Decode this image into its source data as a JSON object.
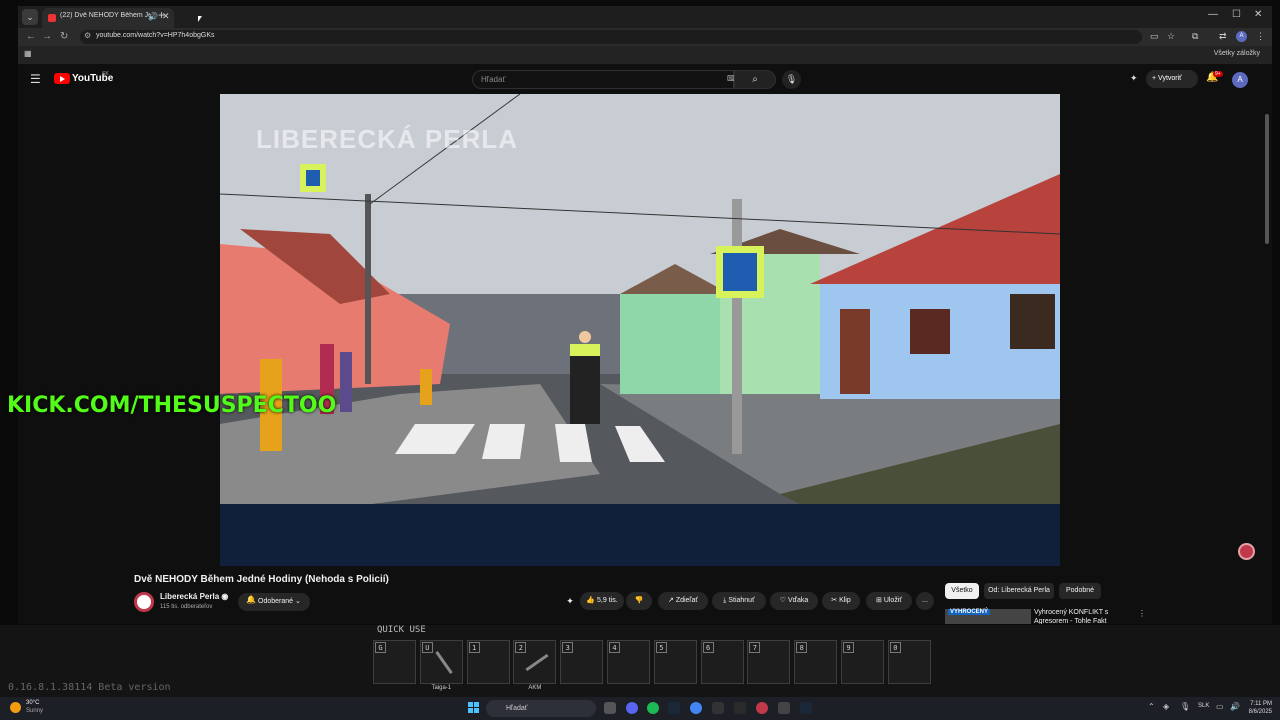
{
  "browser": {
    "tab_title": "(22) Dvě NEHODY Během Jedné Hodiny (Nehoda s Policií) - YouTube",
    "url": "youtube.com/watch?v=HP7h4obgGKs",
    "bookmarks_label": "Všetky záložky",
    "avatar_letter": "A"
  },
  "youtube": {
    "logo_text": "YouTube",
    "country": "SK",
    "search_placeholder": "Hľadať",
    "create_label": "Vytvoriť",
    "notif_count": "9+",
    "avatar_letter": "A"
  },
  "video": {
    "overlay_channel": "LIBERECKÁ PERLA",
    "kick_overlay": "KICK.COM/THESUSPECTOO",
    "title": "Dvě NEHODY Během Jedné Hodiny (Nehoda s Policií)",
    "channel_name": "Liberecká Perla",
    "channel_subs": "115 tis. odberateľov",
    "subscribe_label": "Odoberané",
    "likes": "5,9 tis.",
    "share_label": "Zdieľať",
    "download_label": "Stiahnuť",
    "thanks_label": "Vďaka",
    "clip_label": "Klip",
    "save_label": "Uložiť",
    "more_label": "..."
  },
  "recommendations": {
    "chips": [
      "Všetko",
      "Od: Liberecká Perla",
      "Podobné"
    ],
    "first_title": "Vyhrocený KONFLIKT s Agresorem - Tohle Fakt",
    "first_thumb_text": "VYHROCENÝ"
  },
  "game_overlay": {
    "quick_use_label": "QUICK USE",
    "slots": [
      {
        "key": "G",
        "name": ""
      },
      {
        "key": "U",
        "name": "Taiga-1"
      },
      {
        "key": "1",
        "name": ""
      },
      {
        "key": "2",
        "name": "AKM"
      },
      {
        "key": "3",
        "name": ""
      },
      {
        "key": "4",
        "name": ""
      },
      {
        "key": "5",
        "name": ""
      },
      {
        "key": "6",
        "name": ""
      },
      {
        "key": "7",
        "name": ""
      },
      {
        "key": "8",
        "name": ""
      },
      {
        "key": "9",
        "name": ""
      },
      {
        "key": "0",
        "name": ""
      }
    ],
    "version": "0.16.8.1.38114 Beta version"
  },
  "taskbar": {
    "weather_temp": "30°C",
    "weather_desc": "Sunny",
    "search_label": "Hľadať",
    "language": "SLK",
    "time": "7:11 PM",
    "date": "8/6/2025"
  },
  "colors": {
    "kick_green": "#53fc18",
    "yt_red": "#ff0000",
    "accent_blue": "#4cc2ff"
  }
}
